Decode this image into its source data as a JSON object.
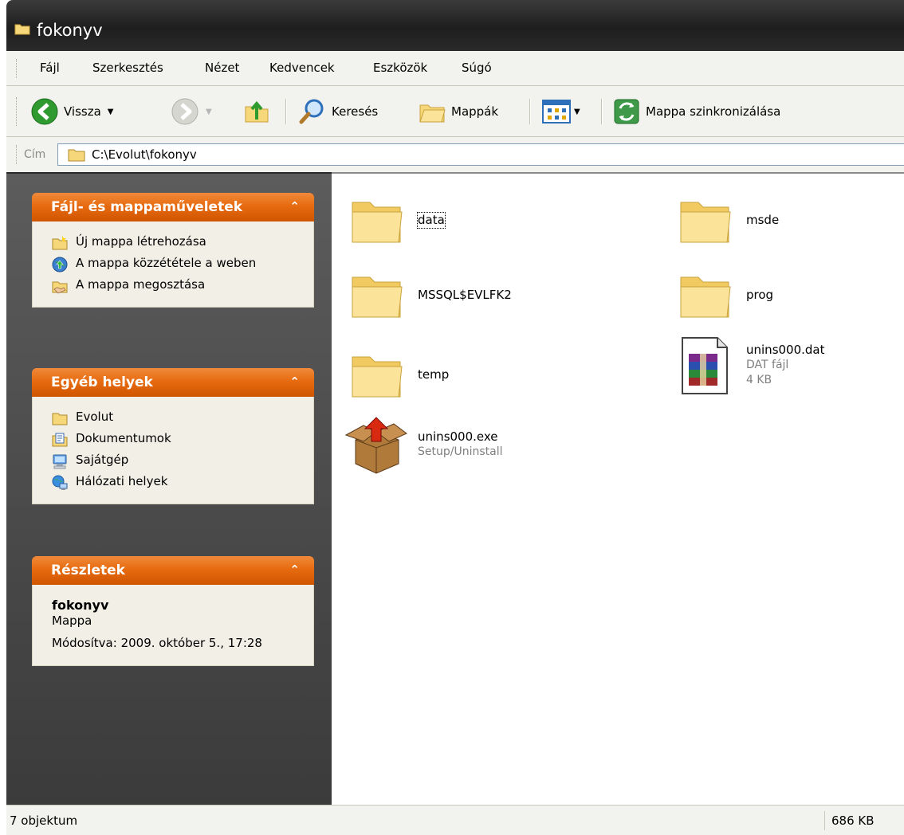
{
  "window": {
    "title": "fokonyv"
  },
  "menu": [
    "Fájl",
    "Szerkesztés",
    "Nézet",
    "Kedvencek",
    "Eszközök",
    "Súgó"
  ],
  "toolbar": {
    "back_label": "Vissza",
    "search_label": "Keresés",
    "folders_label": "Mappák",
    "sync_label": "Mappa szinkronizálása"
  },
  "address": {
    "label": "Cím",
    "path": "C:\\Evolut\\fokonyv"
  },
  "tasks_panel": {
    "title": "Fájl- és mappaműveletek",
    "links": [
      "Új mappa létrehozása",
      "A mappa közzététele a weben",
      "A mappa megosztása"
    ]
  },
  "places_panel": {
    "title": "Egyéb helyek",
    "links": [
      "Evolut",
      "Dokumentumok",
      "Sajátgép",
      "Hálózati helyek"
    ]
  },
  "details_panel": {
    "title": "Részletek",
    "name": "fokonyv",
    "type": "Mappa",
    "modified": "Módosítva: 2009. október 5., 17:28"
  },
  "files": [
    {
      "name": "data",
      "kind": "folder"
    },
    {
      "name": "msde",
      "kind": "folder"
    },
    {
      "name": "MSSQL$EVLFK2",
      "kind": "folder"
    },
    {
      "name": "prog",
      "kind": "folder"
    },
    {
      "name": "temp",
      "kind": "folder"
    },
    {
      "name": "unins000.dat",
      "kind": "dat",
      "type": "DAT fájl",
      "size": "4 KB"
    },
    {
      "name": "unins000.exe",
      "kind": "exe",
      "type": "Setup/Uninstall"
    }
  ],
  "status": {
    "count": "7 objektum",
    "size": "686 KB"
  },
  "colors": {
    "panel_header": "#e76b10",
    "titlebar": "#2a2a2a",
    "left_pane": "#4b4b4b"
  }
}
